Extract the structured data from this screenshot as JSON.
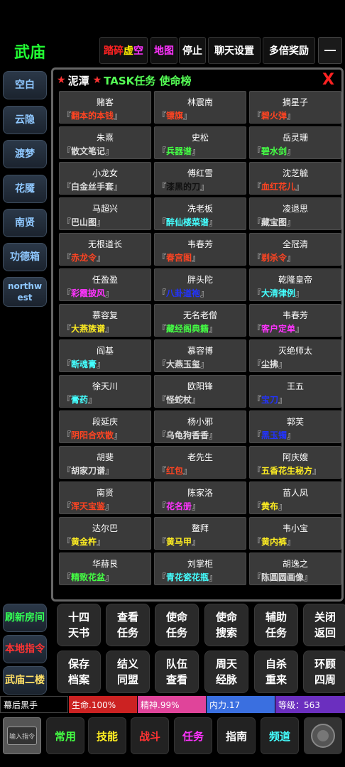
{
  "header": {
    "title": "武庙",
    "buttons": [
      {
        "label": "踏碎虚空",
        "parts": [
          "踏碎",
          "虚",
          "空"
        ]
      },
      {
        "label": "地图"
      },
      {
        "label": "停止"
      },
      {
        "label": "聊天设置"
      },
      {
        "label": "多倍奖励"
      }
    ]
  },
  "sidebar_top": [
    "空白",
    "云隐",
    "渡梦",
    "花魇",
    "南贤",
    "功德箱",
    "northwest"
  ],
  "sidebar_bottom": [
    "刷新房间",
    "本地指令",
    "武庙二楼"
  ],
  "panel": {
    "location": "泥潭",
    "title": "TASK任务 使命榜",
    "close": "X",
    "tasks": [
      {
        "npc": "赌客",
        "item": "翻本的本钱",
        "color": "#ff4422"
      },
      {
        "npc": "林震南",
        "item": "镖旗",
        "color": "#ff4422"
      },
      {
        "npc": "摘星子",
        "item": "碧火弹",
        "color": "#ff4422"
      },
      {
        "npc": "朱熹",
        "item": "散文笔记",
        "color": "#dddddd"
      },
      {
        "npc": "史松",
        "item": "兵器谱",
        "color": "#44ff44"
      },
      {
        "npc": "岳灵珊",
        "item": "碧水剑",
        "color": "#44ff44"
      },
      {
        "npc": "小龙女",
        "item": "白金丝手套",
        "color": "#dddddd"
      },
      {
        "npc": "傅红雪",
        "item": "漆黑的刀",
        "color": "#111111"
      },
      {
        "npc": "沈芝毓",
        "item": "血红花儿",
        "color": "#ff4422"
      },
      {
        "npc": "马超兴",
        "item": "巴山图",
        "color": "#dddddd"
      },
      {
        "npc": "冼老板",
        "item": "醉仙楼菜谱",
        "color": "#44ffff"
      },
      {
        "npc": "凌退思",
        "item": "藏宝图",
        "color": "#dddddd"
      },
      {
        "npc": "无根道长",
        "item": "赤龙令",
        "color": "#ff4422"
      },
      {
        "npc": "韦春芳",
        "item": "春宫图",
        "color": "#ff4422"
      },
      {
        "npc": "全冠清",
        "item": "剃杀令",
        "color": "#ff4422"
      },
      {
        "npc": "任盈盈",
        "item": "彩霞披风",
        "color": "#ff33ff"
      },
      {
        "npc": "胖头陀",
        "item": "八卦道袍",
        "color": "#2233ff"
      },
      {
        "npc": "乾隆皇帝",
        "item": "大清律例",
        "color": "#44ffff"
      },
      {
        "npc": "慕容复",
        "item": "大燕族谱",
        "color": "#ffee22"
      },
      {
        "npc": "无名老僧",
        "item": "藏经阁典籍",
        "color": "#44ff44"
      },
      {
        "npc": "韦春芳",
        "item": "客户定单",
        "color": "#ff33ff"
      },
      {
        "npc": "阎基",
        "item": "断魂膏",
        "color": "#44ffff"
      },
      {
        "npc": "慕容博",
        "item": "大燕玉玺",
        "color": "#dddddd"
      },
      {
        "npc": "灭绝师太",
        "item": "尘拂",
        "color": "#dddddd"
      },
      {
        "npc": "徐天川",
        "item": "膏药",
        "color": "#44ffff"
      },
      {
        "npc": "欧阳锋",
        "item": "怪蛇杖",
        "color": "#dddddd"
      },
      {
        "npc": "王五",
        "item": "宝刀",
        "color": "#2233ff"
      },
      {
        "npc": "段延庆",
        "item": "阴阳合欢散",
        "color": "#ff4422"
      },
      {
        "npc": "杨小邪",
        "item": "乌龟狗香香",
        "color": "#dddddd"
      },
      {
        "npc": "郭芙",
        "item": "黑玉镯",
        "color": "#2233ff"
      },
      {
        "npc": "胡斐",
        "item": "胡家刀谱",
        "color": "#dddddd"
      },
      {
        "npc": "老先生",
        "item": "红包",
        "color": "#ff4422"
      },
      {
        "npc": "阿庆嫂",
        "item": "五香花生秘方",
        "color": "#ffee22"
      },
      {
        "npc": "南贤",
        "item": "浑天宝鉴",
        "color": "#ff4422"
      },
      {
        "npc": "陈家洛",
        "item": "花名册",
        "color": "#ff33ff"
      },
      {
        "npc": "苗人凤",
        "item": "黄布",
        "color": "#ffee22"
      },
      {
        "npc": "达尔巴",
        "item": "黄金杵",
        "color": "#ffee22"
      },
      {
        "npc": "鳌拜",
        "item": "黄马甲",
        "color": "#ffee22"
      },
      {
        "npc": "韦小宝",
        "item": "黄内裤",
        "color": "#ffee22"
      },
      {
        "npc": "华赫艮",
        "item": "精致花盆",
        "color": "#44ff44"
      },
      {
        "npc": "刘掌柜",
        "item": "青花瓷花瓶",
        "color": "#44ffff"
      },
      {
        "npc": "胡逸之",
        "item": "陈圆圆画像",
        "color": "#dddddd"
      }
    ]
  },
  "actions": [
    [
      "十四\n天书",
      "查看\n任务",
      "使命\n任务",
      "使命\n搜索",
      "辅助\n任务",
      "关闭\n返回"
    ],
    [
      "保存\n档案",
      "结义\n同盟",
      "队伍\n查看",
      "周天\n经脉",
      "自杀\n重来",
      "环顾\n四周"
    ]
  ],
  "status": {
    "name": "幕后黑手",
    "hp": "生命.100%",
    "spirit": "精神.99%",
    "force": "内力.17",
    "level": "等级：563"
  },
  "bottom_nav": {
    "input_label": "输入指令",
    "tabs": [
      {
        "label": "常用",
        "color": "#44ff44"
      },
      {
        "label": "技能",
        "color": "#ffee22"
      },
      {
        "label": "战斗",
        "color": "#ff3333"
      },
      {
        "label": "任务",
        "color": "#ff33ff"
      },
      {
        "label": "指南",
        "color": "#ffffff"
      },
      {
        "label": "频道",
        "color": "#44ffff"
      }
    ]
  }
}
